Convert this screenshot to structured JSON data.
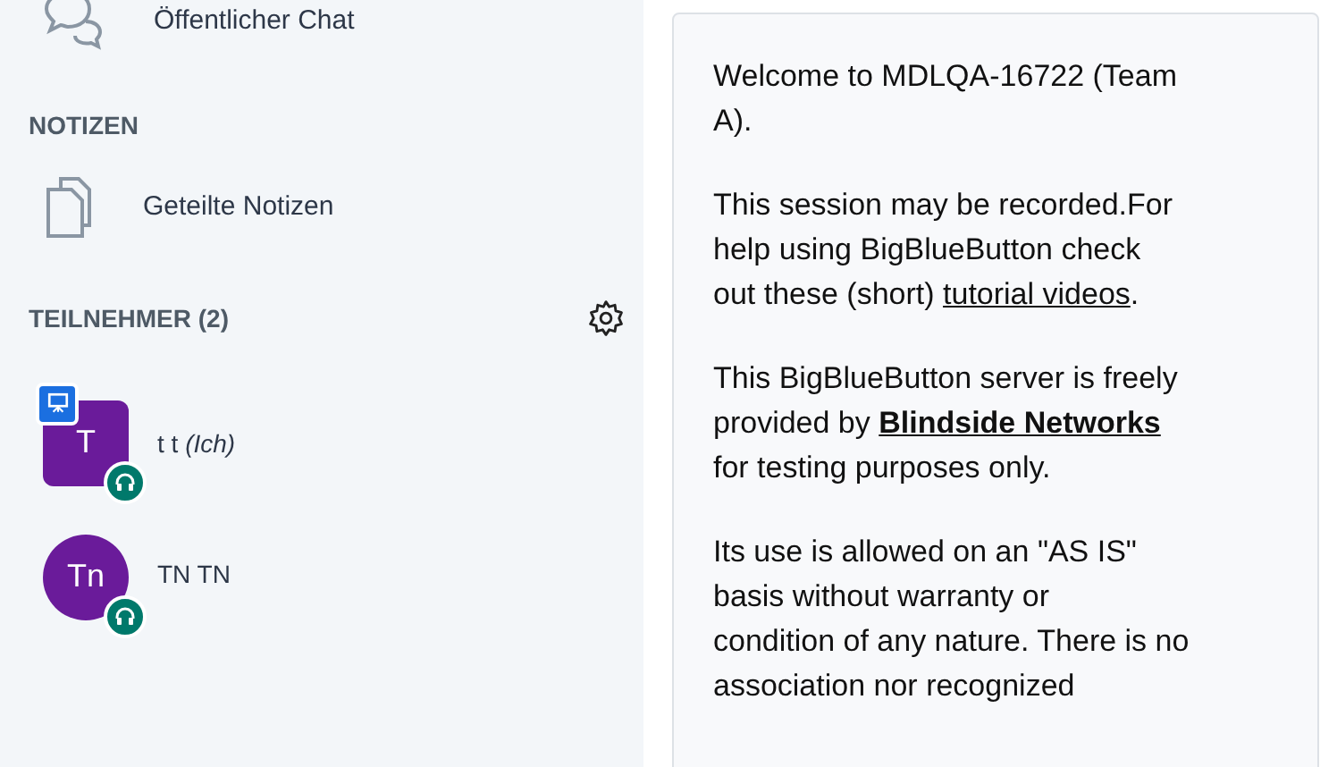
{
  "sidebar": {
    "chat": {
      "label": "Öffentlicher Chat"
    },
    "notes_header": "NOTIZEN",
    "notes": {
      "label": "Geteilte Notizen"
    },
    "users_header": "TEILNEHMER (2)",
    "users": [
      {
        "initials": "T",
        "name": "t t",
        "suffix": "(Ich)",
        "presenter": true,
        "kind": "square",
        "color": "#6a1b9a"
      },
      {
        "initials": "Tn",
        "name": "TN TN",
        "presenter": false,
        "kind": "circle",
        "color": "#6a1b9a"
      }
    ]
  },
  "welcome": {
    "paragraphs": [
      [
        [
          {
            "text": "Welcome to MDLQA-16722 (Team"
          }
        ],
        [
          {
            "text": "A)."
          }
        ]
      ],
      [
        [
          {
            "text": "This session may be recorded.For"
          }
        ],
        [
          {
            "text": "help using BigBlueButton check"
          }
        ],
        [
          {
            "text": "out these (short) "
          },
          {
            "text": "tutorial videos",
            "kind": "link",
            "bold": false
          },
          {
            "text": "."
          }
        ]
      ],
      [
        [
          {
            "text": "This BigBlueButton server is freely"
          }
        ],
        [
          {
            "text": "provided by "
          },
          {
            "text": "Blindside Networks",
            "kind": "link",
            "bold": true
          }
        ],
        [
          {
            "text": "for testing purposes only."
          }
        ]
      ],
      [
        [
          {
            "text": "Its use is allowed on an \"AS IS\""
          }
        ],
        [
          {
            "text": "basis without warranty or"
          }
        ],
        [
          {
            "text": "condition of any nature. There is no"
          }
        ],
        [
          {
            "text": "association nor recognized"
          }
        ]
      ]
    ]
  }
}
